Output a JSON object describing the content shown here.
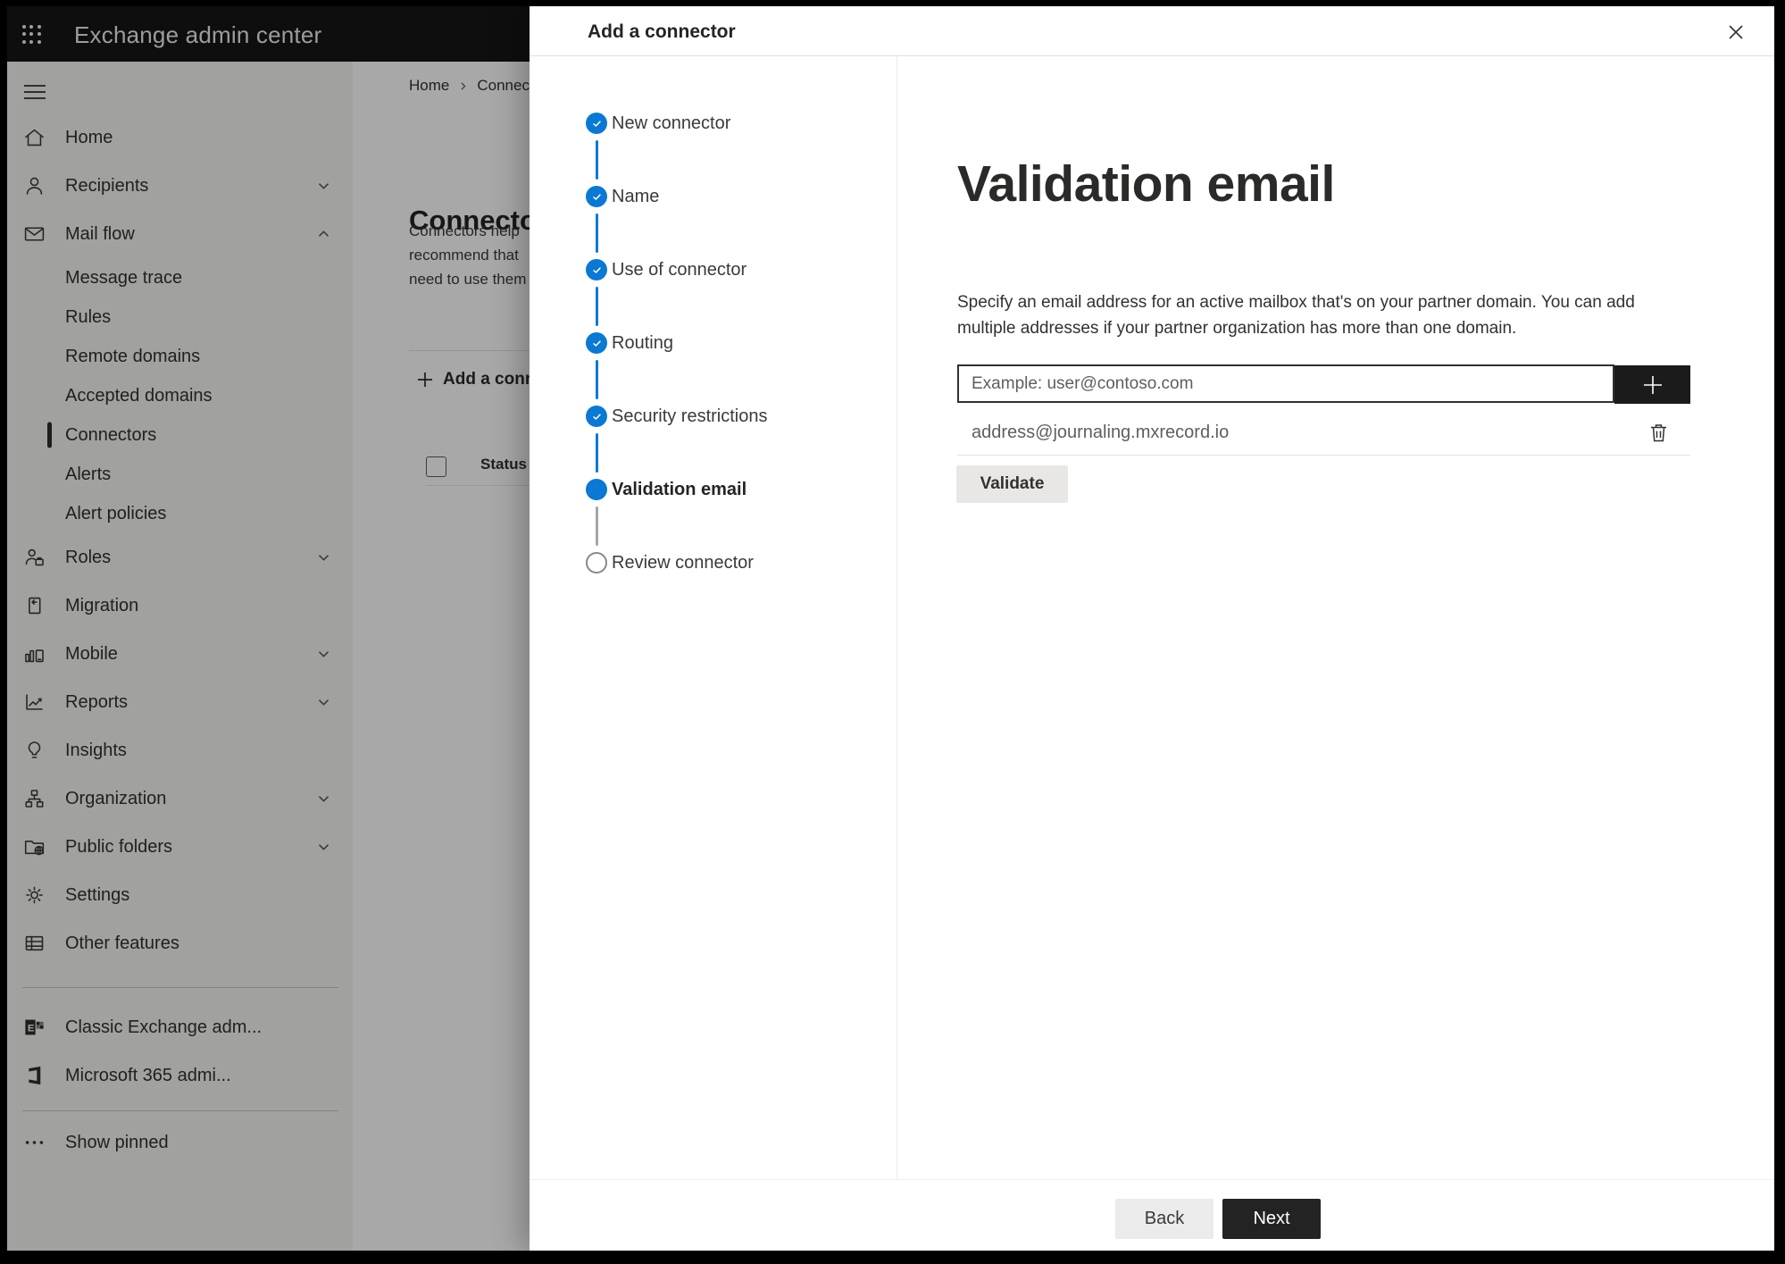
{
  "header": {
    "title": "Exchange admin center"
  },
  "sidebar": {
    "items": [
      {
        "label": "Home",
        "icon": "home"
      },
      {
        "label": "Recipients",
        "icon": "person",
        "chevron": "down"
      },
      {
        "label": "Mail flow",
        "icon": "mail",
        "chevron": "up"
      },
      {
        "label": "Message trace",
        "sub": true
      },
      {
        "label": "Rules",
        "sub": true
      },
      {
        "label": "Remote domains",
        "sub": true
      },
      {
        "label": "Accepted domains",
        "sub": true
      },
      {
        "label": "Connectors",
        "sub": true,
        "selected": true
      },
      {
        "label": "Alerts",
        "sub": true
      },
      {
        "label": "Alert policies",
        "sub": true
      },
      {
        "label": "Roles",
        "icon": "roles",
        "chevron": "down"
      },
      {
        "label": "Migration",
        "icon": "migration"
      },
      {
        "label": "Mobile",
        "icon": "mobile",
        "chevron": "down"
      },
      {
        "label": "Reports",
        "icon": "reports",
        "chevron": "down"
      },
      {
        "label": "Insights",
        "icon": "insights"
      },
      {
        "label": "Organization",
        "icon": "organization",
        "chevron": "down"
      },
      {
        "label": "Public folders",
        "icon": "folders",
        "chevron": "down"
      },
      {
        "label": "Settings",
        "icon": "settings"
      },
      {
        "label": "Other features",
        "icon": "grid"
      }
    ],
    "footer_items": [
      {
        "label": "Classic Exchange adm...",
        "icon": "exchange"
      },
      {
        "label": "Microsoft 365 admi...",
        "icon": "m365"
      }
    ],
    "pinned_item": {
      "label": "Show pinned",
      "icon": "dots"
    }
  },
  "page": {
    "breadcrumb": {
      "home": "Home",
      "current": "Connectors"
    },
    "title": "Connectors",
    "description_lines": [
      "Connectors help",
      "recommend that",
      "need to use them"
    ],
    "add_button": "Add a connector",
    "status_column": "Status"
  },
  "modal": {
    "title": "Add a connector",
    "steps": [
      {
        "label": "New connector",
        "state": "done"
      },
      {
        "label": "Name",
        "state": "done"
      },
      {
        "label": "Use of connector",
        "state": "done"
      },
      {
        "label": "Routing",
        "state": "done"
      },
      {
        "label": "Security restrictions",
        "state": "done"
      },
      {
        "label": "Validation email",
        "state": "current"
      },
      {
        "label": "Review connector",
        "state": "todo"
      }
    ],
    "content": {
      "heading": "Validation email",
      "description_lines": [
        "Specify an email address for an active mailbox that's on your partner domain. You can add",
        "multiple addresses if your partner organization has more than one domain."
      ],
      "email_placeholder": "Example: user@contoso.com",
      "added_email": "address@journaling.mxrecord.io",
      "validate_button": "Validate",
      "back_button": "Back",
      "next_button": "Next"
    }
  },
  "colors": {
    "accent_blue": "#0b78d4",
    "topbar_bg": "#161616",
    "dark_button": "#1b1b1b",
    "dim_overlay": "rgba(0,0,0,0.34)"
  }
}
